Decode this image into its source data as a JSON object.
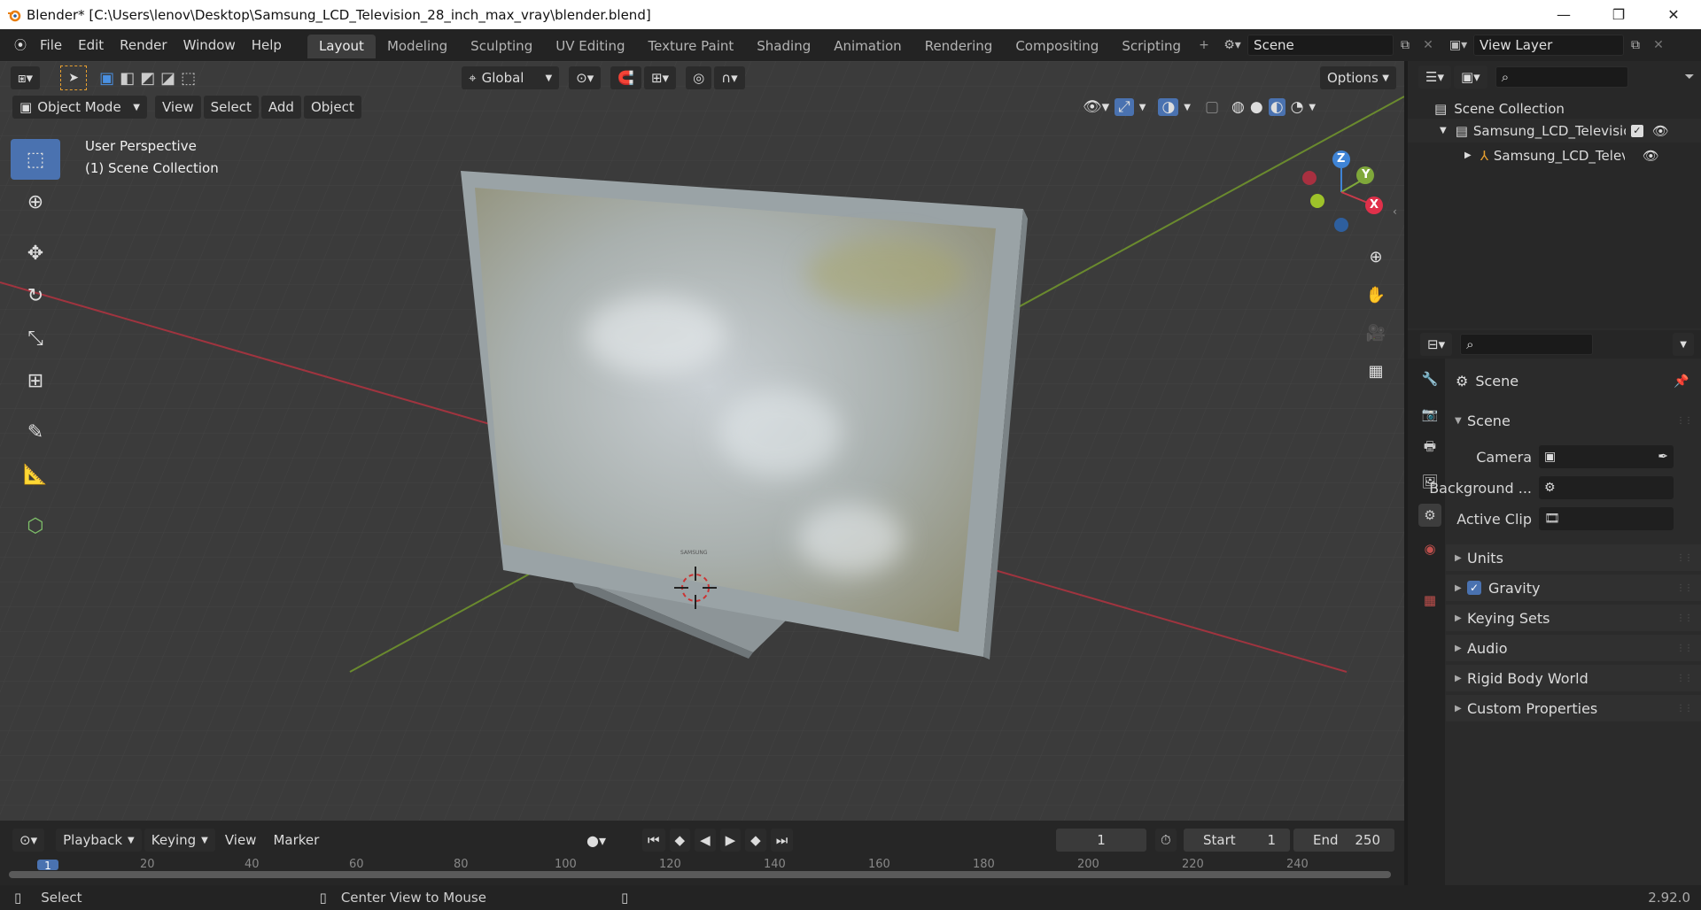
{
  "window": {
    "title": "Blender* [C:\\Users\\lenov\\Desktop\\Samsung_LCD_Television_28_inch_max_vray\\blender.blend]",
    "minimize": "—",
    "restore": "❐",
    "close": "✕"
  },
  "menus": [
    "File",
    "Edit",
    "Render",
    "Window",
    "Help"
  ],
  "workspaces": [
    "Layout",
    "Modeling",
    "Sculpting",
    "UV Editing",
    "Texture Paint",
    "Shading",
    "Animation",
    "Rendering",
    "Compositing",
    "Scripting"
  ],
  "active_workspace": "Layout",
  "scene_name": "Scene",
  "view_layer": "View Layer",
  "toolbar": {
    "transform_orientation": "Global",
    "options": "Options"
  },
  "viewport_header": {
    "mode": "Object Mode",
    "menus": [
      "View",
      "Select",
      "Add",
      "Object"
    ]
  },
  "viewport": {
    "perspective": "User Perspective",
    "collection": "(1) Scene Collection"
  },
  "gizmo": {
    "z": "Z",
    "y": "Y",
    "x": "X"
  },
  "timeline": {
    "menus": [
      "Playback",
      "Keying",
      "View",
      "Marker"
    ],
    "current_frame": "1",
    "start_label": "Start",
    "start": "1",
    "end_label": "End",
    "end": "250",
    "ruler": [
      "1",
      "20",
      "40",
      "60",
      "80",
      "100",
      "120",
      "140",
      "160",
      "180",
      "200",
      "220",
      "240"
    ]
  },
  "outliner": {
    "root": "Scene Collection",
    "collection": "Samsung_LCD_Televisior",
    "object": "Samsung_LCD_Telev"
  },
  "properties": {
    "header": "Scene",
    "panel": "Scene",
    "camera_label": "Camera",
    "background_label": "Background ...",
    "clip_label": "Active Clip",
    "sections": [
      "Units",
      "Gravity",
      "Keying Sets",
      "Audio",
      "Rigid Body World",
      "Custom Properties"
    ]
  },
  "status": {
    "select": "Select",
    "center": "Center View to Mouse",
    "version": "2.92.0"
  },
  "colors": {
    "accent": "#4a72b0",
    "x_axis": "#c83a4a",
    "y_axis": "#7fa83a",
    "z_axis": "#3f84d6",
    "tv_frame": "#9aa3a6"
  }
}
